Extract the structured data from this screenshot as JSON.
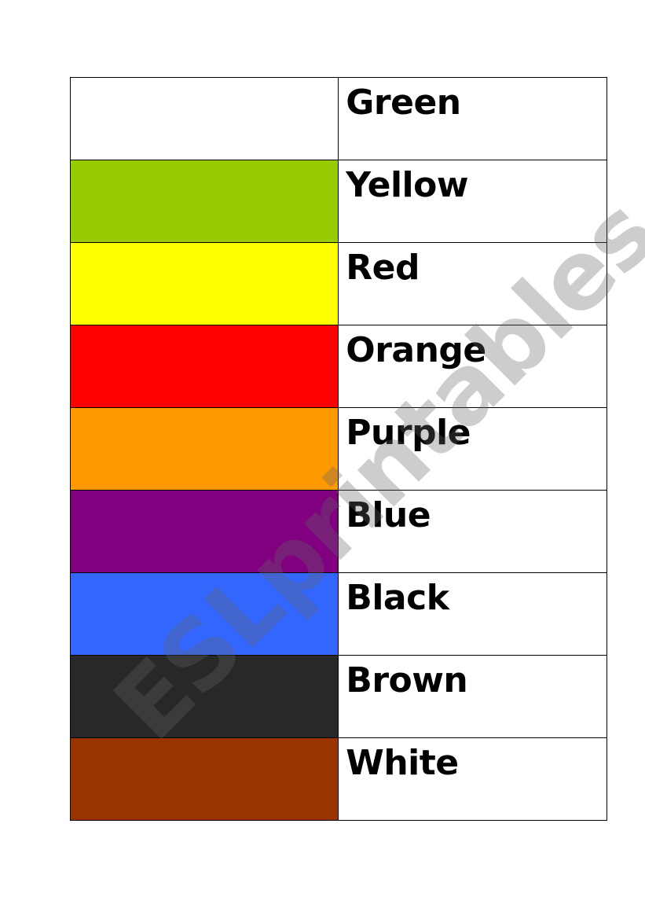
{
  "rows": [
    {
      "swatch_color": "#ffffff",
      "label": "Green"
    },
    {
      "swatch_color": "#99cc00",
      "label": "Yellow"
    },
    {
      "swatch_color": "#ffff00",
      "label": "Red"
    },
    {
      "swatch_color": "#ff0000",
      "label": "Orange"
    },
    {
      "swatch_color": "#ff9900",
      "label": "Purple"
    },
    {
      "swatch_color": "#800080",
      "label": "Blue"
    },
    {
      "swatch_color": "#3366ff",
      "label": "Black"
    },
    {
      "swatch_color": "#282828",
      "label": "Brown"
    },
    {
      "swatch_color": "#993300",
      "label": "White"
    }
  ],
  "watermark": "ESLprintables.com"
}
